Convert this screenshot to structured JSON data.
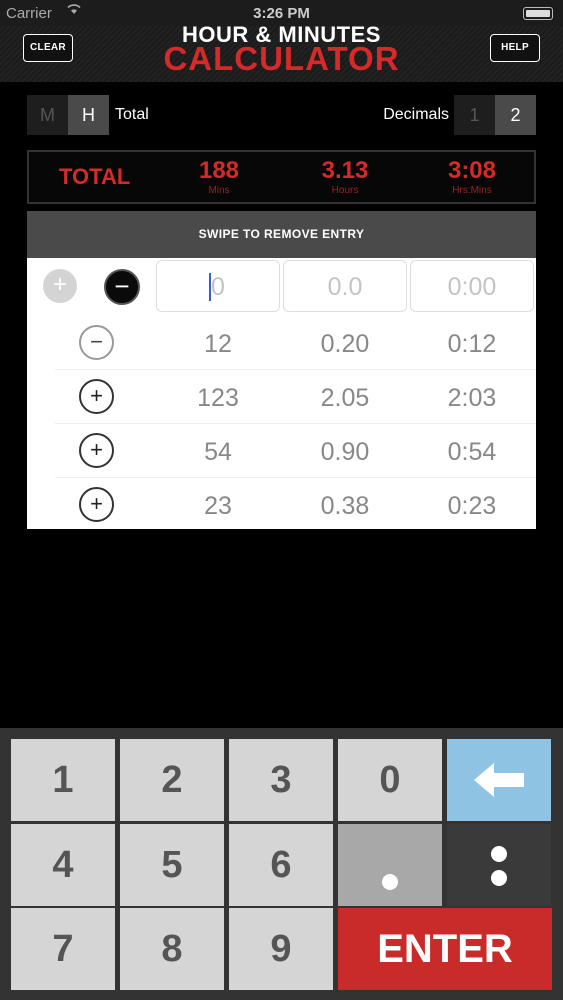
{
  "status_bar": {
    "carrier": "Carrier",
    "time": "3:26 PM"
  },
  "header": {
    "clear_label": "CLEAR",
    "help_label": "HELP",
    "title_line1": "HOUR & MINUTES",
    "title_line2": "CALCULATOR"
  },
  "mode": {
    "m_label": "M",
    "h_label": "H",
    "selected": "H",
    "total_label": "Total",
    "decimals_label": "Decimals",
    "decimal_options": [
      "1",
      "2"
    ],
    "decimal_selected": "2"
  },
  "totals": {
    "label": "TOTAL",
    "mins_value": "188",
    "mins_unit": "Mins",
    "hours_value": "3.13",
    "hours_unit": "Hours",
    "hrsmins_value": "3:08",
    "hrsmins_unit": "Hrs:Mins"
  },
  "swipe_hint": "SWIPE TO REMOVE ENTRY",
  "input_row": {
    "add_symbol": "+",
    "subtract_symbol": "−",
    "mins_value": "0",
    "hours_value": "0.0",
    "hrsmins_value": "0:00"
  },
  "entries": [
    {
      "sign": "−",
      "mins": "12",
      "hours": "0.20",
      "hrsmins": "0:12"
    },
    {
      "sign": "+",
      "mins": "123",
      "hours": "2.05",
      "hrsmins": "2:03"
    },
    {
      "sign": "+",
      "mins": "54",
      "hours": "0.90",
      "hrsmins": "0:54"
    },
    {
      "sign": "+",
      "mins": "23",
      "hours": "0.38",
      "hrsmins": "0:23"
    }
  ],
  "keypad": {
    "k1": "1",
    "k2": "2",
    "k3": "3",
    "k0": "0",
    "k4": "4",
    "k5": "5",
    "k6": "6",
    "k7": "7",
    "k8": "8",
    "k9": "9",
    "enter_label": "ENTER",
    "backspace_icon": "left-arrow-icon",
    "decimal_icon": "dot-icon",
    "colon_icon": "colon-icon"
  },
  "colors": {
    "accent_red": "#d42a2a",
    "backspace_blue": "#8fc3e4",
    "enter_red": "#c92a2a"
  }
}
